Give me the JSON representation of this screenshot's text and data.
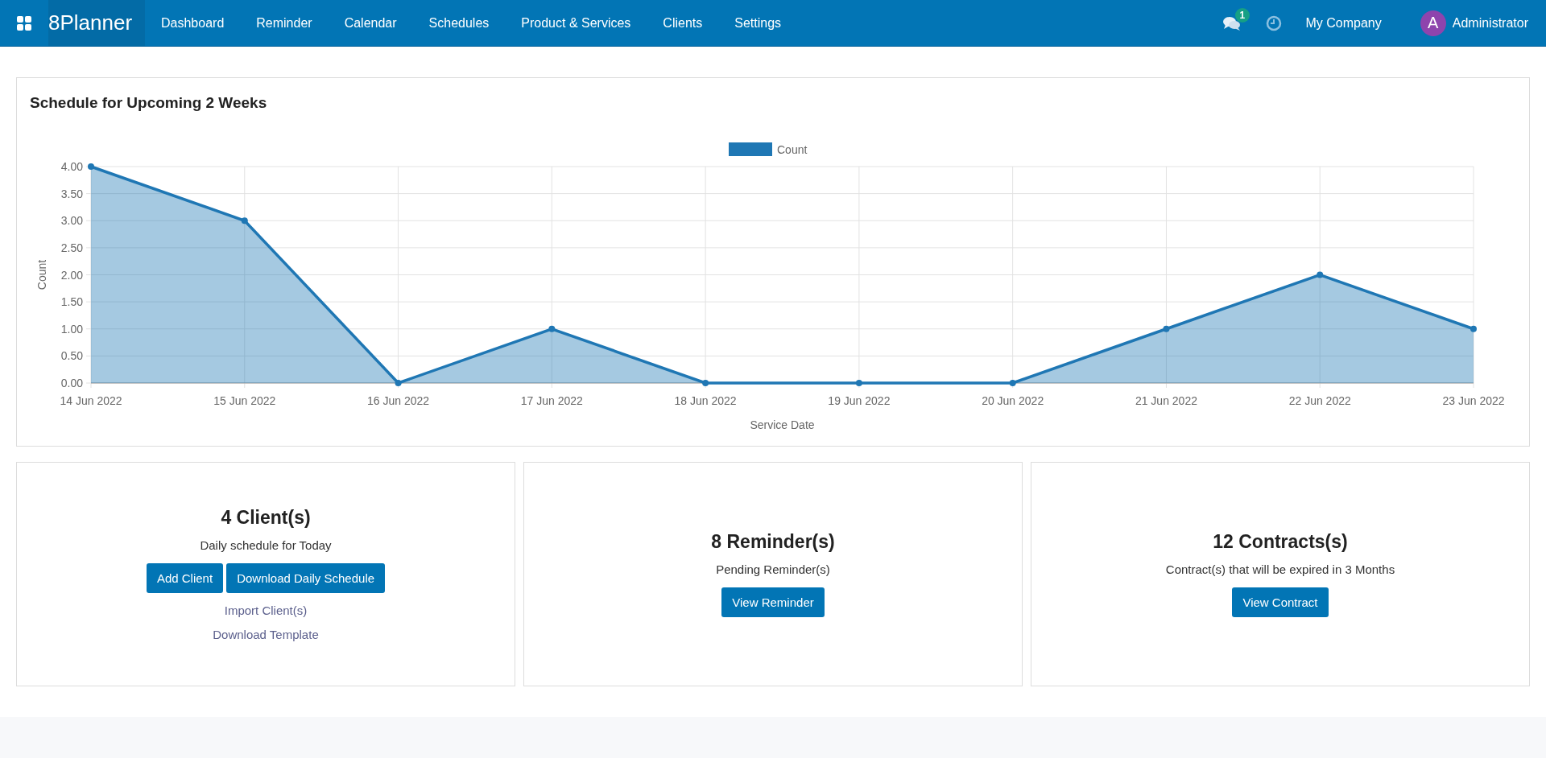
{
  "navbar": {
    "brand": "8Planner",
    "menu": [
      {
        "label": "Dashboard",
        "selected": false
      },
      {
        "label": "Reminder",
        "selected": false
      },
      {
        "label": "Calendar",
        "selected": false
      },
      {
        "label": "Schedules",
        "selected": false
      },
      {
        "label": "Product & Services",
        "selected": false
      },
      {
        "label": "Clients",
        "selected": false
      },
      {
        "label": "Settings",
        "selected": false
      }
    ],
    "messages_badge": "1",
    "company": "My Company",
    "user": {
      "initial": "A",
      "name": "Administrator"
    }
  },
  "schedule_card": {
    "title": "Schedule for Upcoming 2 Weeks",
    "chart_data": {
      "type": "area",
      "grid": true,
      "xlabel": "Service Date",
      "ylabel": "Count",
      "categories": [
        "14 Jun 2022",
        "15 Jun 2022",
        "16 Jun 2022",
        "17 Jun 2022",
        "18 Jun 2022",
        "19 Jun 2022",
        "20 Jun 2022",
        "21 Jun 2022",
        "22 Jun 2022",
        "23 Jun 2022"
      ],
      "series": [
        {
          "name": "Count",
          "color": "#1f77b4",
          "values": [
            4,
            3,
            0,
            1,
            0,
            0,
            0,
            1,
            2,
            1
          ]
        }
      ],
      "ylim": [
        0,
        4
      ],
      "yticks": [
        {
          "value": 0,
          "label": "0.00"
        },
        {
          "value": 0.5,
          "label": "0.50"
        },
        {
          "value": 1,
          "label": "1.00"
        },
        {
          "value": 1.5,
          "label": "1.50"
        },
        {
          "value": 2,
          "label": "2.00"
        },
        {
          "value": 2.5,
          "label": "2.50"
        },
        {
          "value": 3,
          "label": "3.00"
        },
        {
          "value": 3.5,
          "label": "3.50"
        },
        {
          "value": 4,
          "label": "4.00"
        }
      ]
    }
  },
  "summary_cards": [
    {
      "heading": "4 Client(s)",
      "subtitle": "Daily schedule for Today",
      "buttons": [
        "Add Client",
        "Download Daily Schedule"
      ],
      "links": [
        "Import Client(s)",
        "Download Template"
      ]
    },
    {
      "heading": "8 Reminder(s)",
      "subtitle": "Pending Reminder(s)",
      "buttons": [
        "View Reminder"
      ]
    },
    {
      "heading": "12 Contracts(s)",
      "subtitle": "Contract(s) that will be expired in 3 Months",
      "buttons": [
        "View Contract"
      ]
    }
  ]
}
